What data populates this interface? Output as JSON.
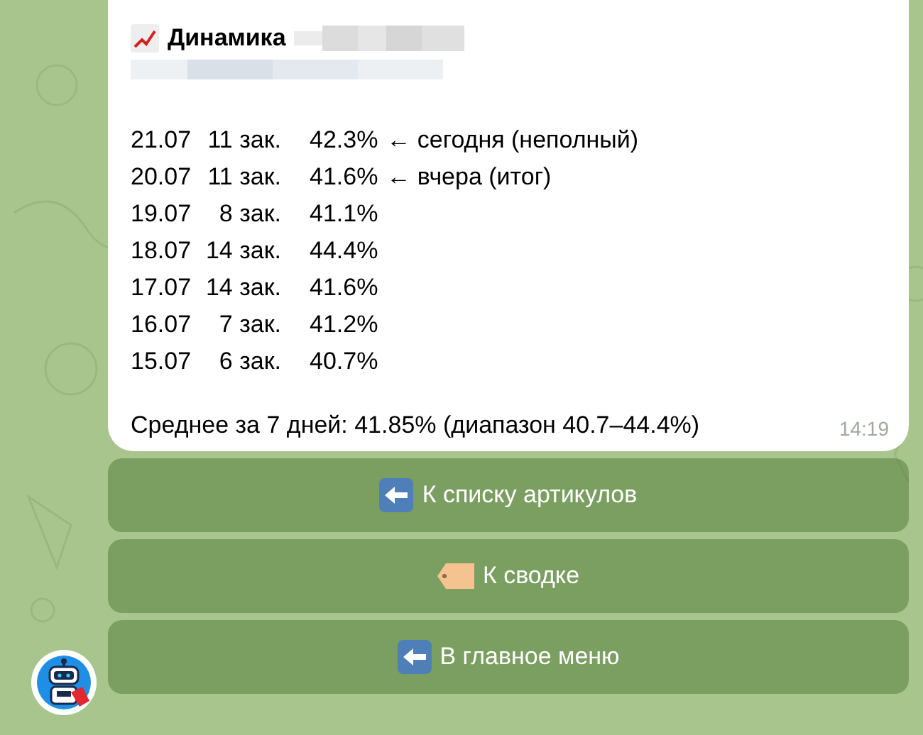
{
  "message": {
    "title": "Динамика",
    "rows": [
      {
        "date": "21.07",
        "orders": "11 зак.",
        "percent": "42.3%",
        "note": "← сегодня (неполный)"
      },
      {
        "date": "20.07",
        "orders": "11 зак.",
        "percent": "41.6%",
        "note": "← вчера (итог)"
      },
      {
        "date": "19.07",
        "orders": "8 зак.",
        "percent": "41.1%"
      },
      {
        "date": "18.07",
        "orders": "14 зак.",
        "percent": "44.4%"
      },
      {
        "date": "17.07",
        "orders": "14 зак.",
        "percent": "41.6%"
      },
      {
        "date": "16.07",
        "orders": "7 зак.",
        "percent": "41.2%"
      },
      {
        "date": "15.07",
        "orders": "6 зак.",
        "percent": "40.7%"
      }
    ],
    "summary": "Среднее за 7 дней: 41.85% (диапазон 40.7–44.4%)",
    "time": "14:19"
  },
  "buttons": [
    {
      "label": "К списку артикулов",
      "kind": "back"
    },
    {
      "label": "К сводке",
      "kind": "tag"
    },
    {
      "label": "В главное меню",
      "kind": "back"
    }
  ]
}
